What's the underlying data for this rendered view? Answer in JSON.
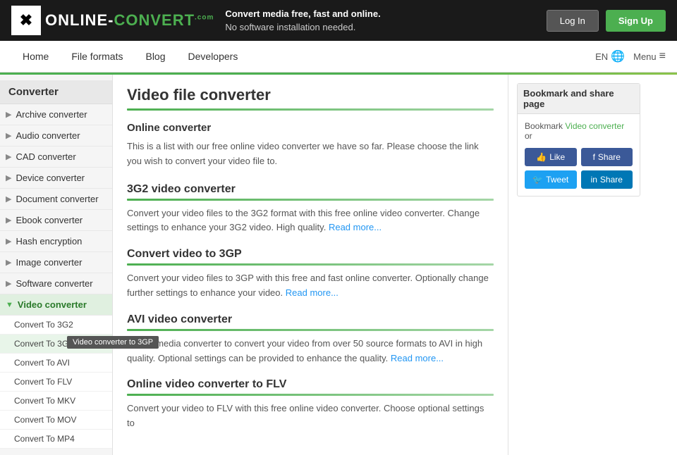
{
  "header": {
    "logo_text": "ONLINE-CONVERT",
    "logo_com": ".com",
    "tagline_line1": "Convert media free, fast and online.",
    "tagline_line2": "No software installation needed.",
    "btn_login": "Log In",
    "btn_signup": "Sign Up"
  },
  "navbar": {
    "links": [
      "Home",
      "File formats",
      "Blog",
      "Developers"
    ],
    "lang": "EN",
    "menu": "Menu"
  },
  "sidebar": {
    "title": "Converter",
    "items": [
      {
        "label": "Archive converter",
        "active": false
      },
      {
        "label": "Audio converter",
        "active": false
      },
      {
        "label": "CAD converter",
        "active": false
      },
      {
        "label": "Device converter",
        "active": false
      },
      {
        "label": "Document converter",
        "active": false
      },
      {
        "label": "Ebook converter",
        "active": false
      },
      {
        "label": "Hash encryption",
        "active": false
      },
      {
        "label": "Image converter",
        "active": false
      },
      {
        "label": "Software converter",
        "active": false
      },
      {
        "label": "Video converter",
        "active": true
      }
    ],
    "sub_items": [
      {
        "label": "Convert To 3G2",
        "highlighted": false
      },
      {
        "label": "Convert To 3GP",
        "highlighted": true,
        "tooltip": "Video converter to 3GP"
      },
      {
        "label": "Convert To AVI",
        "highlighted": false
      },
      {
        "label": "Convert To FLV",
        "highlighted": false
      },
      {
        "label": "Convert To MKV",
        "highlighted": false
      },
      {
        "label": "Convert To MOV",
        "highlighted": false
      },
      {
        "label": "Convert To MP4",
        "highlighted": false
      }
    ]
  },
  "content": {
    "page_title": "Video file converter",
    "online_converter_heading": "Online converter",
    "online_converter_text": "This is a list with our free online video converter we have so far. Please choose the link you wish to convert your video file to.",
    "sections": [
      {
        "title": "3G2 video converter",
        "text": "Convert your video files to the 3G2 format with this free online video converter. Change settings to enhance your 3G2 video. High quality.",
        "read_more": "Read more..."
      },
      {
        "title": "Convert video to 3GP",
        "text": "Convert your video files to 3GP with this free and fast online converter. Optionally change further settings to enhance your video.",
        "read_more": "Read more..."
      },
      {
        "title": "AVI video converter",
        "text": "Online media converter to convert your video from over 50 source formats to AVI in high quality. Optional settings can be provided to enhance the quality.",
        "read_more": "Read more..."
      },
      {
        "title": "Online video converter to FLV",
        "text": "Convert your video to FLV with this free online video converter. Choose optional settings to",
        "read_more": ""
      }
    ]
  },
  "right_sidebar": {
    "bookmark_title": "Bookmark and share page",
    "bookmark_text_pre": "Bookmark ",
    "bookmark_link": "Video converter",
    "bookmark_text_post": " or",
    "buttons": [
      {
        "label": "Like",
        "type": "fb-like"
      },
      {
        "label": "Share",
        "type": "fb-share"
      },
      {
        "label": "Tweet",
        "type": "twitter"
      },
      {
        "label": "Share",
        "type": "linkedin"
      }
    ]
  }
}
